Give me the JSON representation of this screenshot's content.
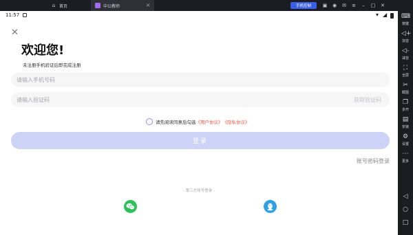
{
  "emulator": {
    "tabs": [
      {
        "label": "首页"
      },
      {
        "label": "中公教师"
      }
    ],
    "phone_control_label": "手机控制",
    "sidebar": [
      {
        "label": "按键",
        "icon": "keyboard-icon"
      },
      {
        "label": "加音",
        "icon": "volume-up-icon"
      },
      {
        "label": "减音",
        "icon": "volume-down-icon"
      },
      {
        "label": "全屏",
        "icon": "fullscreen-icon"
      },
      {
        "label": "截图",
        "icon": "scissors-icon"
      },
      {
        "label": "多开",
        "icon": "multi-instance-icon"
      },
      {
        "label": "安装",
        "icon": "apk-install-icon"
      },
      {
        "label": "设置",
        "icon": "settings-icon"
      },
      {
        "label": "更多",
        "icon": "more-icon"
      }
    ],
    "nav": {
      "back": "◁",
      "home": "○",
      "recents": "□"
    }
  },
  "status_bar": {
    "time": "11:57"
  },
  "login": {
    "welcome": "欢迎您!",
    "subtitle": "未注册手机验证后即完成注册",
    "phone_placeholder": "请输入手机号码",
    "code_placeholder": "请输入验证码",
    "get_code": "获取验证码",
    "agree_prefix": "请先阅读同意后勾选",
    "user_agreement": "《用户协议》",
    "privacy_policy": "《隐私协议》",
    "login_button": "登录",
    "account_login": "账号密码登录",
    "third_party_title": "- 第三方账号登录 -"
  },
  "colors": {
    "accent": "#cdd3f7",
    "link": "#f05a4a",
    "wechat": "#2dc15a",
    "qq": "#2f9fe6"
  }
}
